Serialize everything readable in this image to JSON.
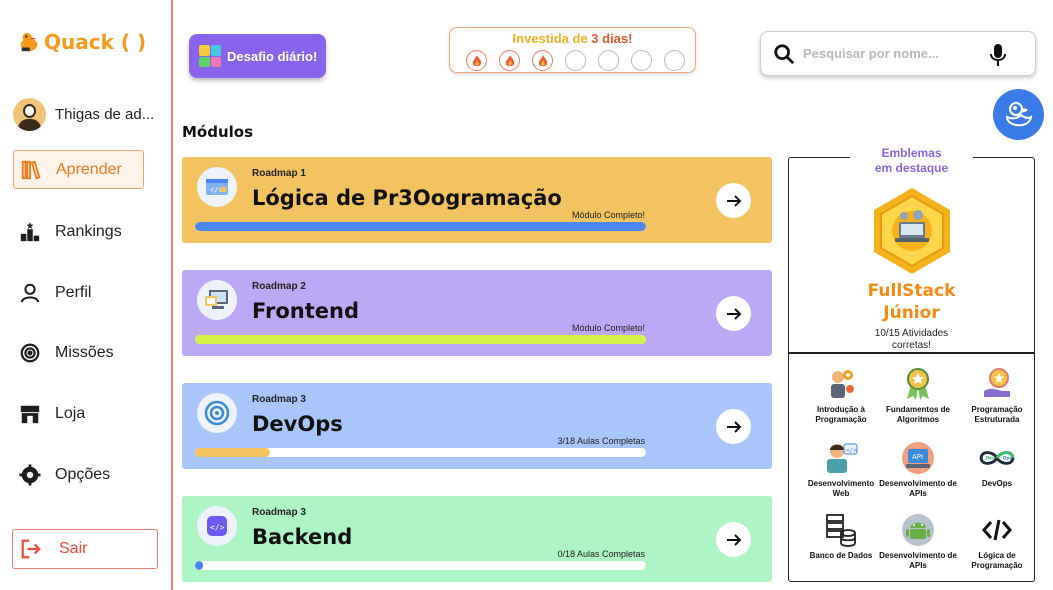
{
  "app": {
    "name": "Quack ( )"
  },
  "user": {
    "name": "Thigas de ad..."
  },
  "nav": {
    "items": [
      {
        "label": "Aprender",
        "active": true
      },
      {
        "label": "Rankings"
      },
      {
        "label": "Perfil"
      },
      {
        "label": "Missões"
      },
      {
        "label": "Loja"
      },
      {
        "label": "Opções"
      }
    ],
    "logout": "Sair"
  },
  "header": {
    "daily_challenge": "Desafio diário!",
    "streak": {
      "title_prefix": "Investida de ",
      "title_days": "3 dias!",
      "active_days": 3,
      "total_days": 7
    },
    "search_placeholder": "Pesquisar por nome..."
  },
  "modules": {
    "title": "Módulos",
    "items": [
      {
        "roadmap": "Roadmap 1",
        "name": "Lógica de Pr3Oogramação",
        "status": "Módulo Completo!",
        "progress": 1.0,
        "bg": "#f4c361",
        "bar": "#4a86f0",
        "icon": "code-window-icon"
      },
      {
        "roadmap": "Roadmap 2",
        "name": "Frontend",
        "status": "Módulo Completo!",
        "progress": 1.0,
        "bg": "#bca9f6",
        "bar": "#d4f245",
        "icon": "browser-icon"
      },
      {
        "roadmap": "Roadmap 3",
        "name": "DevOps",
        "status": "3/18 Aulas Completas",
        "progress": 0.1667,
        "bg": "#a9c6fa",
        "bar": "#f4c361",
        "icon": "devops-gear-icon"
      },
      {
        "roadmap": "Roadmap 3",
        "name": "Backend",
        "status": "0/18 Aulas Completas",
        "progress": 0.0,
        "bg": "#adf5c4",
        "bar": "#4a86f0",
        "icon": "backend-code-icon"
      }
    ]
  },
  "emblems": {
    "title_line1": "Emblemas",
    "title_line2": "em destaque",
    "featured": {
      "name_line1": "FullStack",
      "name_line2": "Júnior",
      "progress_line1": "10/15 Atividades",
      "progress_line2": "corretas!"
    },
    "badges": [
      {
        "label": "Introdução à Programação",
        "icon": "person-gears-icon"
      },
      {
        "label": "Fundamentos de Algoritmos",
        "icon": "award-ribbon-icon"
      },
      {
        "label": "Programação Estruturada",
        "icon": "hand-badge-icon"
      },
      {
        "label": "Desenvolvimento Web",
        "icon": "developer-icon"
      },
      {
        "label": "Desenvolvimento de APIs",
        "icon": "api-person-icon"
      },
      {
        "label": "DevOps",
        "icon": "devops-infinity-icon"
      },
      {
        "label": "Banco de Dados",
        "icon": "database-icon"
      },
      {
        "label": "Desenvolvimento de APIs",
        "icon": "android-icon"
      },
      {
        "label": "Lógica de Programação",
        "icon": "code-brackets-icon"
      }
    ]
  }
}
